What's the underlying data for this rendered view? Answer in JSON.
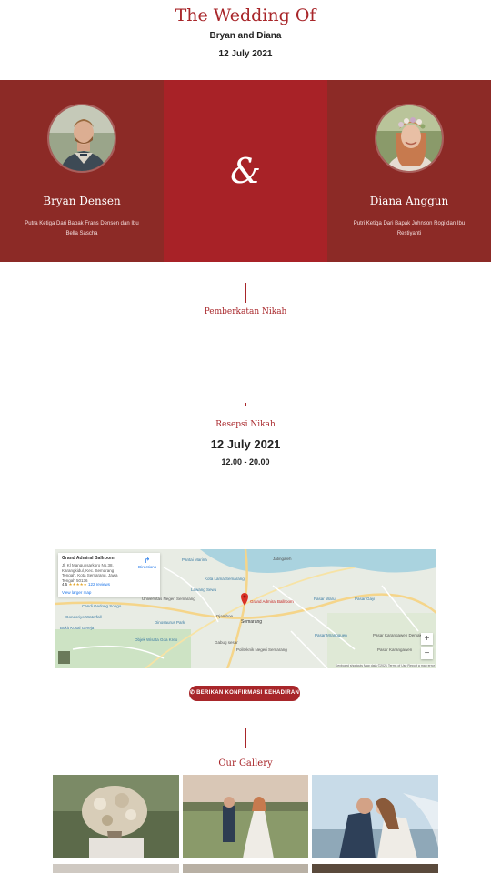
{
  "header": {
    "title": "The Wedding Of",
    "couple_names": "Bryan and Diana",
    "date": "12 July 2021"
  },
  "couple": {
    "groom": {
      "name": "Bryan Densen",
      "description": "Putra Ketiga Dari Bapak Frans Densen dan Ibu Bella Sascha"
    },
    "ampersand": "&",
    "bride": {
      "name": "Diana Anggun",
      "description": "Putri Ketiga Dari Bapak Johnson Rogi dan Ibu Restiyanti"
    }
  },
  "events": {
    "ceremony": {
      "title": "Pemberkatan Nikah"
    },
    "reception": {
      "title": "Resepsi Nikah",
      "date": "12 July 2021",
      "time": "12.00 - 20.00"
    }
  },
  "map": {
    "place_name": "Grand Admiral Ballroom",
    "address": "Jl. Kl Mangunsarkoro No.38, Karangkidul, Kec. Semarang Tengah, Kota Semarang, Jawa Tengah 50136",
    "rating": "4.5",
    "stars": "★★★★★",
    "reviews": "122 reviews",
    "view_larger": "View larger map",
    "directions": "Directions",
    "pin_label": "Grand Admiral Ballroom",
    "city_label": "Semarang",
    "labels": [
      "Pantai Marina",
      "Kota Lama Semarang",
      "Djamboe",
      "Lawang Sewu",
      "Pasar Waru",
      "Pasar Gayi",
      "Universitas Negeri Semarang",
      "Candi Gedong Songo",
      "Pasar Mrangguen",
      "Gondoriyo Waterfall",
      "Dinosaurus Park",
      "Jatingaleh",
      "Bukit Kosal Gereja",
      "Pasar Karangawen",
      "Objek Wisata Goa Kreo",
      "Gabug sesar",
      "Politeknik Negeri Semarang",
      "Pasar Karangawen Demak"
    ],
    "zoom_in": "+",
    "zoom_out": "−",
    "footer": "Keyboard shortcuts   Map data ©2021   Terms of Use   Report a map error"
  },
  "rsvp": {
    "label": "BERIKAN KONFIRMASI KEHADIRAN",
    "icon": "whatsapp-icon"
  },
  "gallery": {
    "title": "Our Gallery"
  },
  "colors": {
    "accent": "#a8262a",
    "panel_dark": "#8c2a26",
    "panel_mid": "#a82227"
  }
}
